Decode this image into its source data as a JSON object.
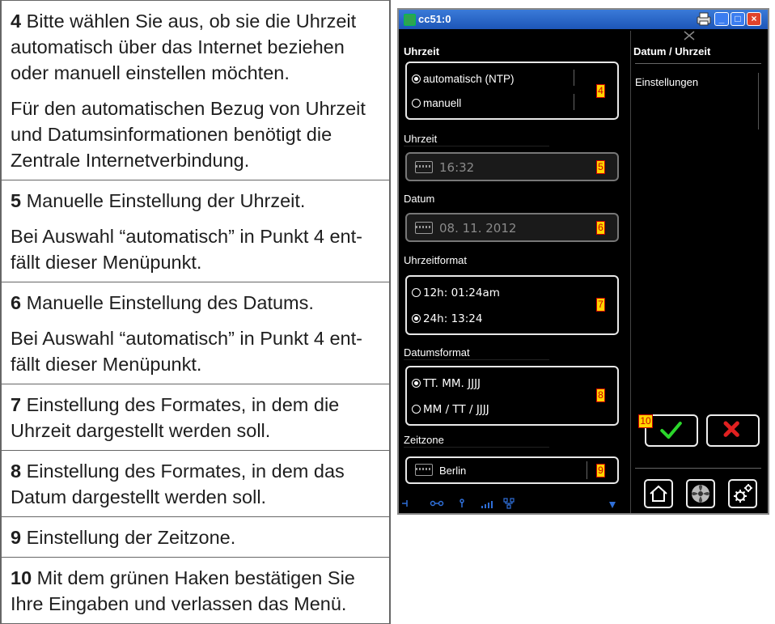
{
  "doc": {
    "rows": [
      {
        "num": "4",
        "p1": "Bitte wählen Sie aus, ob sie die Uhrzeit automatisch über das Internet beziehen oder manuell einstellen möchten.",
        "p2": "Für den automatischen Bezug von Uhrzeit und Datumsinformationen benötigt die Zentrale Internetverbindung."
      },
      {
        "num": "5",
        "p1": "Manuelle Einstellung der Uhrzeit.",
        "p2": "Bei Auswahl “automatisch” in Punkt 4 ent-fällt dieser Menüpunkt."
      },
      {
        "num": "6",
        "p1": "Manuelle Einstellung des Datums.",
        "p2": "Bei Auswahl “automatisch” in Punkt 4 ent-fällt dieser Menüpunkt."
      },
      {
        "num": "7",
        "p1": "Einstellung des Formates, in dem die Uhrzeit dargestellt werden soll."
      },
      {
        "num": "8",
        "p1": "Einstellung des Formates, in dem das Datum dargestellt werden soll."
      },
      {
        "num": "9",
        "p1": "Einstellung der Zeitzone."
      },
      {
        "num": "10",
        "p1": "Mit dem grünen Haken bestätigen Sie Ihre Eingaben und verlassen das Menü."
      }
    ]
  },
  "device": {
    "window_title": "cc51:0",
    "section_time_source": "Uhrzeit",
    "radio_auto": "automatisch (NTP)",
    "radio_manual": "manuell",
    "label_time": "Uhrzeit",
    "time_value": "16:32",
    "label_date": "Datum",
    "date_value": "08. 11. 2012",
    "label_time_format": "Uhrzeitformat",
    "time_format_12h": "12h: 01:24am",
    "time_format_24h": "24h: 13:24",
    "label_date_format": "Datumsformat",
    "date_format_1": "TT. MM. JJJJ",
    "date_format_2": "MM / TT / JJJJ",
    "label_timezone": "Zeitzone",
    "timezone_value": "Berlin",
    "side_title": "Datum / Uhrzeit",
    "side_item": "Einstellungen",
    "markers": [
      "4",
      "5",
      "6",
      "7",
      "8",
      "9",
      "10"
    ],
    "accent_green": "#2bd62b",
    "accent_red": "#e02020"
  }
}
